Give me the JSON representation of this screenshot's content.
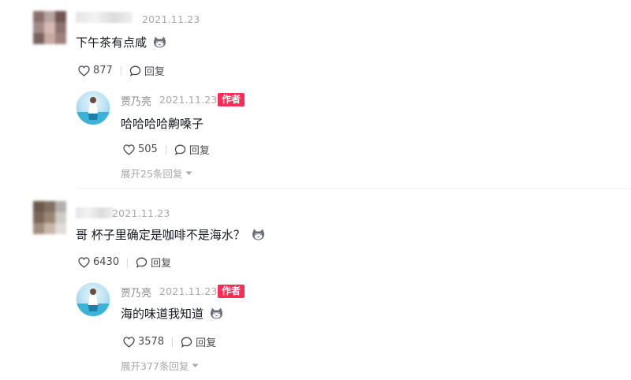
{
  "comments": [
    {
      "date": "2021.11.23",
      "text": "下午茶有点咸",
      "emoji": "cat-emoji",
      "likes": "877",
      "reply_label": "回复",
      "reply": {
        "name": "贾乃亮",
        "date": "2021.11.23",
        "badge": "作者",
        "text": "哈哈哈哈齁嗓子",
        "likes": "505",
        "reply_label": "回复",
        "expand": "展开25条回复"
      }
    },
    {
      "date": "2021.11.23",
      "text": "哥 杯子里确定是咖啡不是海水？",
      "emoji": "cat-emoji",
      "likes": "6430",
      "reply_label": "回复",
      "reply": {
        "name": "贾乃亮",
        "date": "2021.11.23",
        "badge": "作者",
        "text": "海的味道我知道",
        "likes": "3578",
        "reply_label": "回复",
        "expand": "展开377条回复"
      }
    }
  ],
  "colors": {
    "badge": "#fe2c55",
    "muted": "#a8a8ad",
    "text": "#161823"
  }
}
